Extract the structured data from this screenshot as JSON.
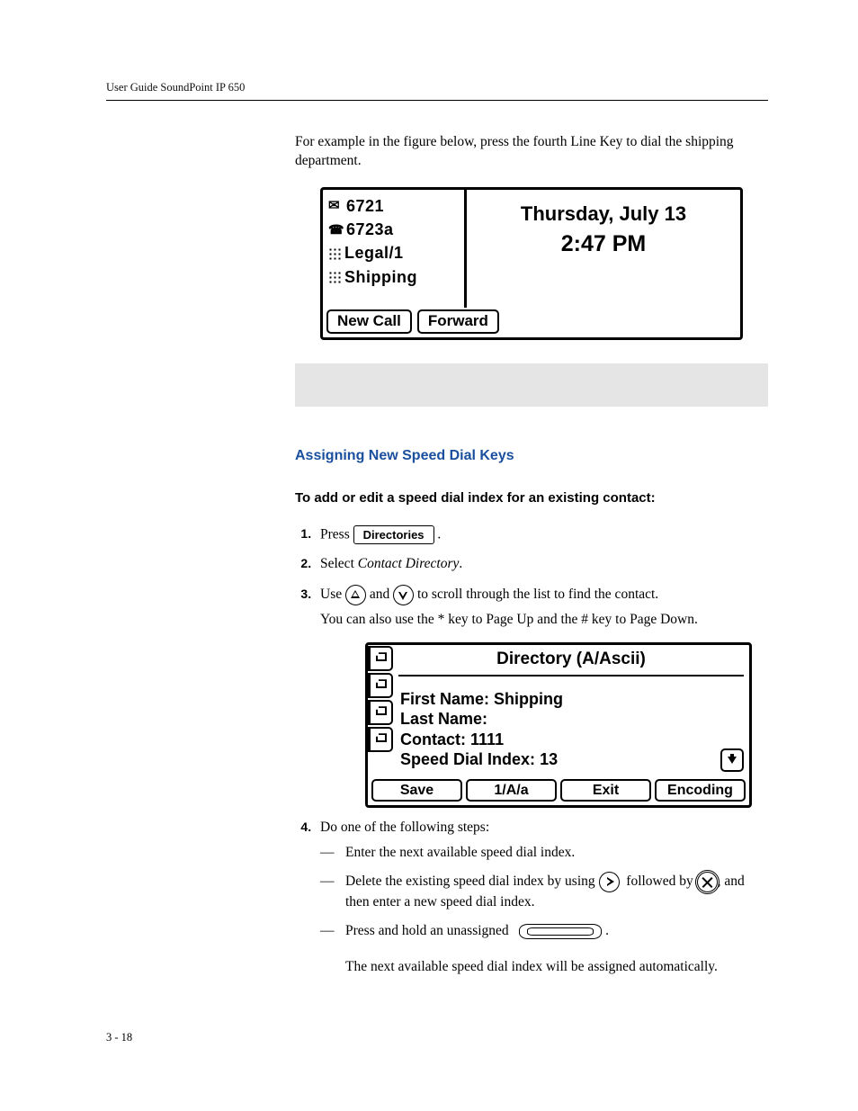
{
  "header": {
    "guide_title": "User Guide SoundPoint IP 650"
  },
  "body": {
    "intro": "For example in the figure below, press the fourth Line Key to dial the shipping department.",
    "section_title": "Assigning New Speed Dial Keys",
    "procedure_heading": "To add or edit a speed dial index for an existing contact:"
  },
  "figure1": {
    "lines": [
      "6721",
      "6723a",
      "Legal/1",
      "Shipping"
    ],
    "date": "Thursday, July 13",
    "time": "2:47 PM",
    "softkeys": [
      "New Call",
      "Forward"
    ]
  },
  "steps": {
    "s1a": "Press ",
    "directories_key": "Directories",
    "s1b": " .",
    "s2a": "Select ",
    "s2_em": "Contact Directory",
    "s2b": ".",
    "s3a": "Use ",
    "s3b": " and ",
    "s3c": " to scroll through the list to find the contact.",
    "s3_note": "You can also use the * key to Page Up and the # key to Page Down.",
    "s4": "Do one of the following steps:",
    "s4_opts": [
      "Enter the next available speed dial index."
    ],
    "s4_opt2a": "Delete the existing speed dial index by using ",
    "s4_opt2b": " followed by ",
    "s4_opt2c": ", ",
    "s4_opt2d": "and then enter a new speed dial index.",
    "s4_opt3a": "Press and hold an unassigned",
    "s4_opt3b": ".",
    "s4_result": "The next available speed dial index will be assigned automatically."
  },
  "figure2": {
    "title": "Directory (A/Ascii)",
    "fields": [
      {
        "label": "First Name:",
        "value": "Shipping"
      },
      {
        "label": "Last Name:",
        "value": ""
      },
      {
        "label": "Contact:",
        "value": "1111"
      },
      {
        "label": "Speed Dial Index:",
        "value": "13"
      }
    ],
    "softkeys": [
      "Save",
      "1/A/a",
      "Exit",
      "Encoding"
    ]
  },
  "footer": {
    "page": "3 - 18"
  }
}
